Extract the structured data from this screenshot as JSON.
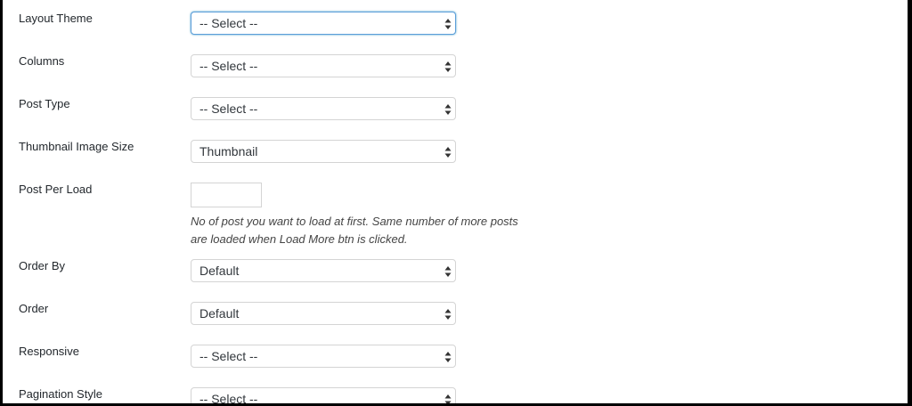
{
  "form": {
    "layout_theme": {
      "label": "Layout Theme",
      "value": "-- Select --"
    },
    "columns": {
      "label": "Columns",
      "value": "-- Select --"
    },
    "post_type": {
      "label": "Post Type",
      "value": "-- Select --"
    },
    "thumbnail_size": {
      "label": "Thumbnail Image Size",
      "value": "Thumbnail"
    },
    "post_per_load": {
      "label": "Post Per Load",
      "value": "",
      "description": "No of post you want to load at first. Same number of more posts are loaded when Load More btn is clicked."
    },
    "order_by": {
      "label": "Order By",
      "value": "Default"
    },
    "order": {
      "label": "Order",
      "value": "Default"
    },
    "responsive": {
      "label": "Responsive",
      "value": "-- Select --"
    },
    "pagination_style": {
      "label": "Pagination Style",
      "value": "-- Select --"
    }
  },
  "colors": {
    "focus_border": "#5b9dd9",
    "field_border": "#d4d4d4",
    "label_text": "#23282d"
  },
  "icons": {
    "select_caret": "up-down-arrows-icon"
  }
}
